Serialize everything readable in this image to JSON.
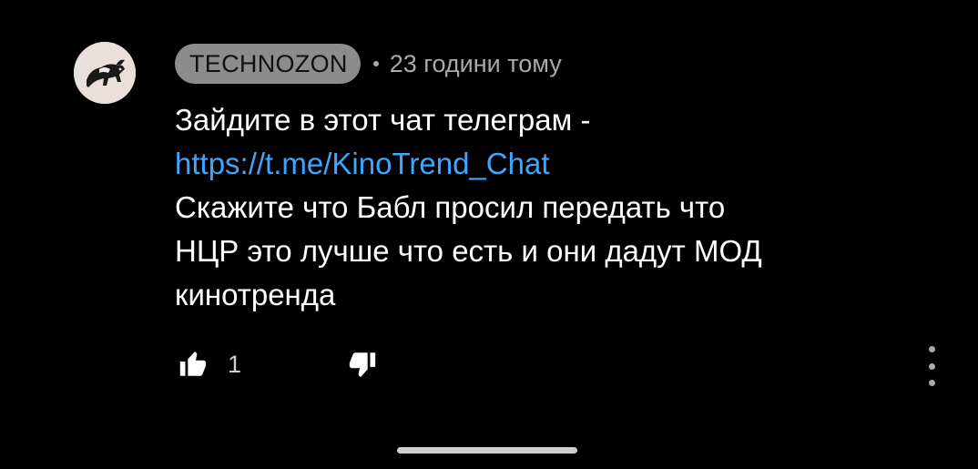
{
  "comment": {
    "author": "TECHNOZON",
    "separator": "•",
    "timestamp": "23 години тому",
    "lines": [
      "Зайдите в этот чат телеграм  -",
      "https://t.me/KinoTrend_Chat",
      "Скажите что Бабл просил передать что",
      "НЦР это лучше что есть и они дадут МОД",
      "кинотренда"
    ],
    "like_count": "1"
  },
  "icons": {
    "avatar": "bull-avatar",
    "like": "thumbs-up-icon",
    "dislike": "thumbs-down-icon",
    "more": "more-vertical-icon"
  },
  "colors": {
    "background": "#000000",
    "text": "#ffffff",
    "secondary": "#aaaaaa",
    "author_pill": "#8c8c8c",
    "link": "#3ea6ff"
  }
}
